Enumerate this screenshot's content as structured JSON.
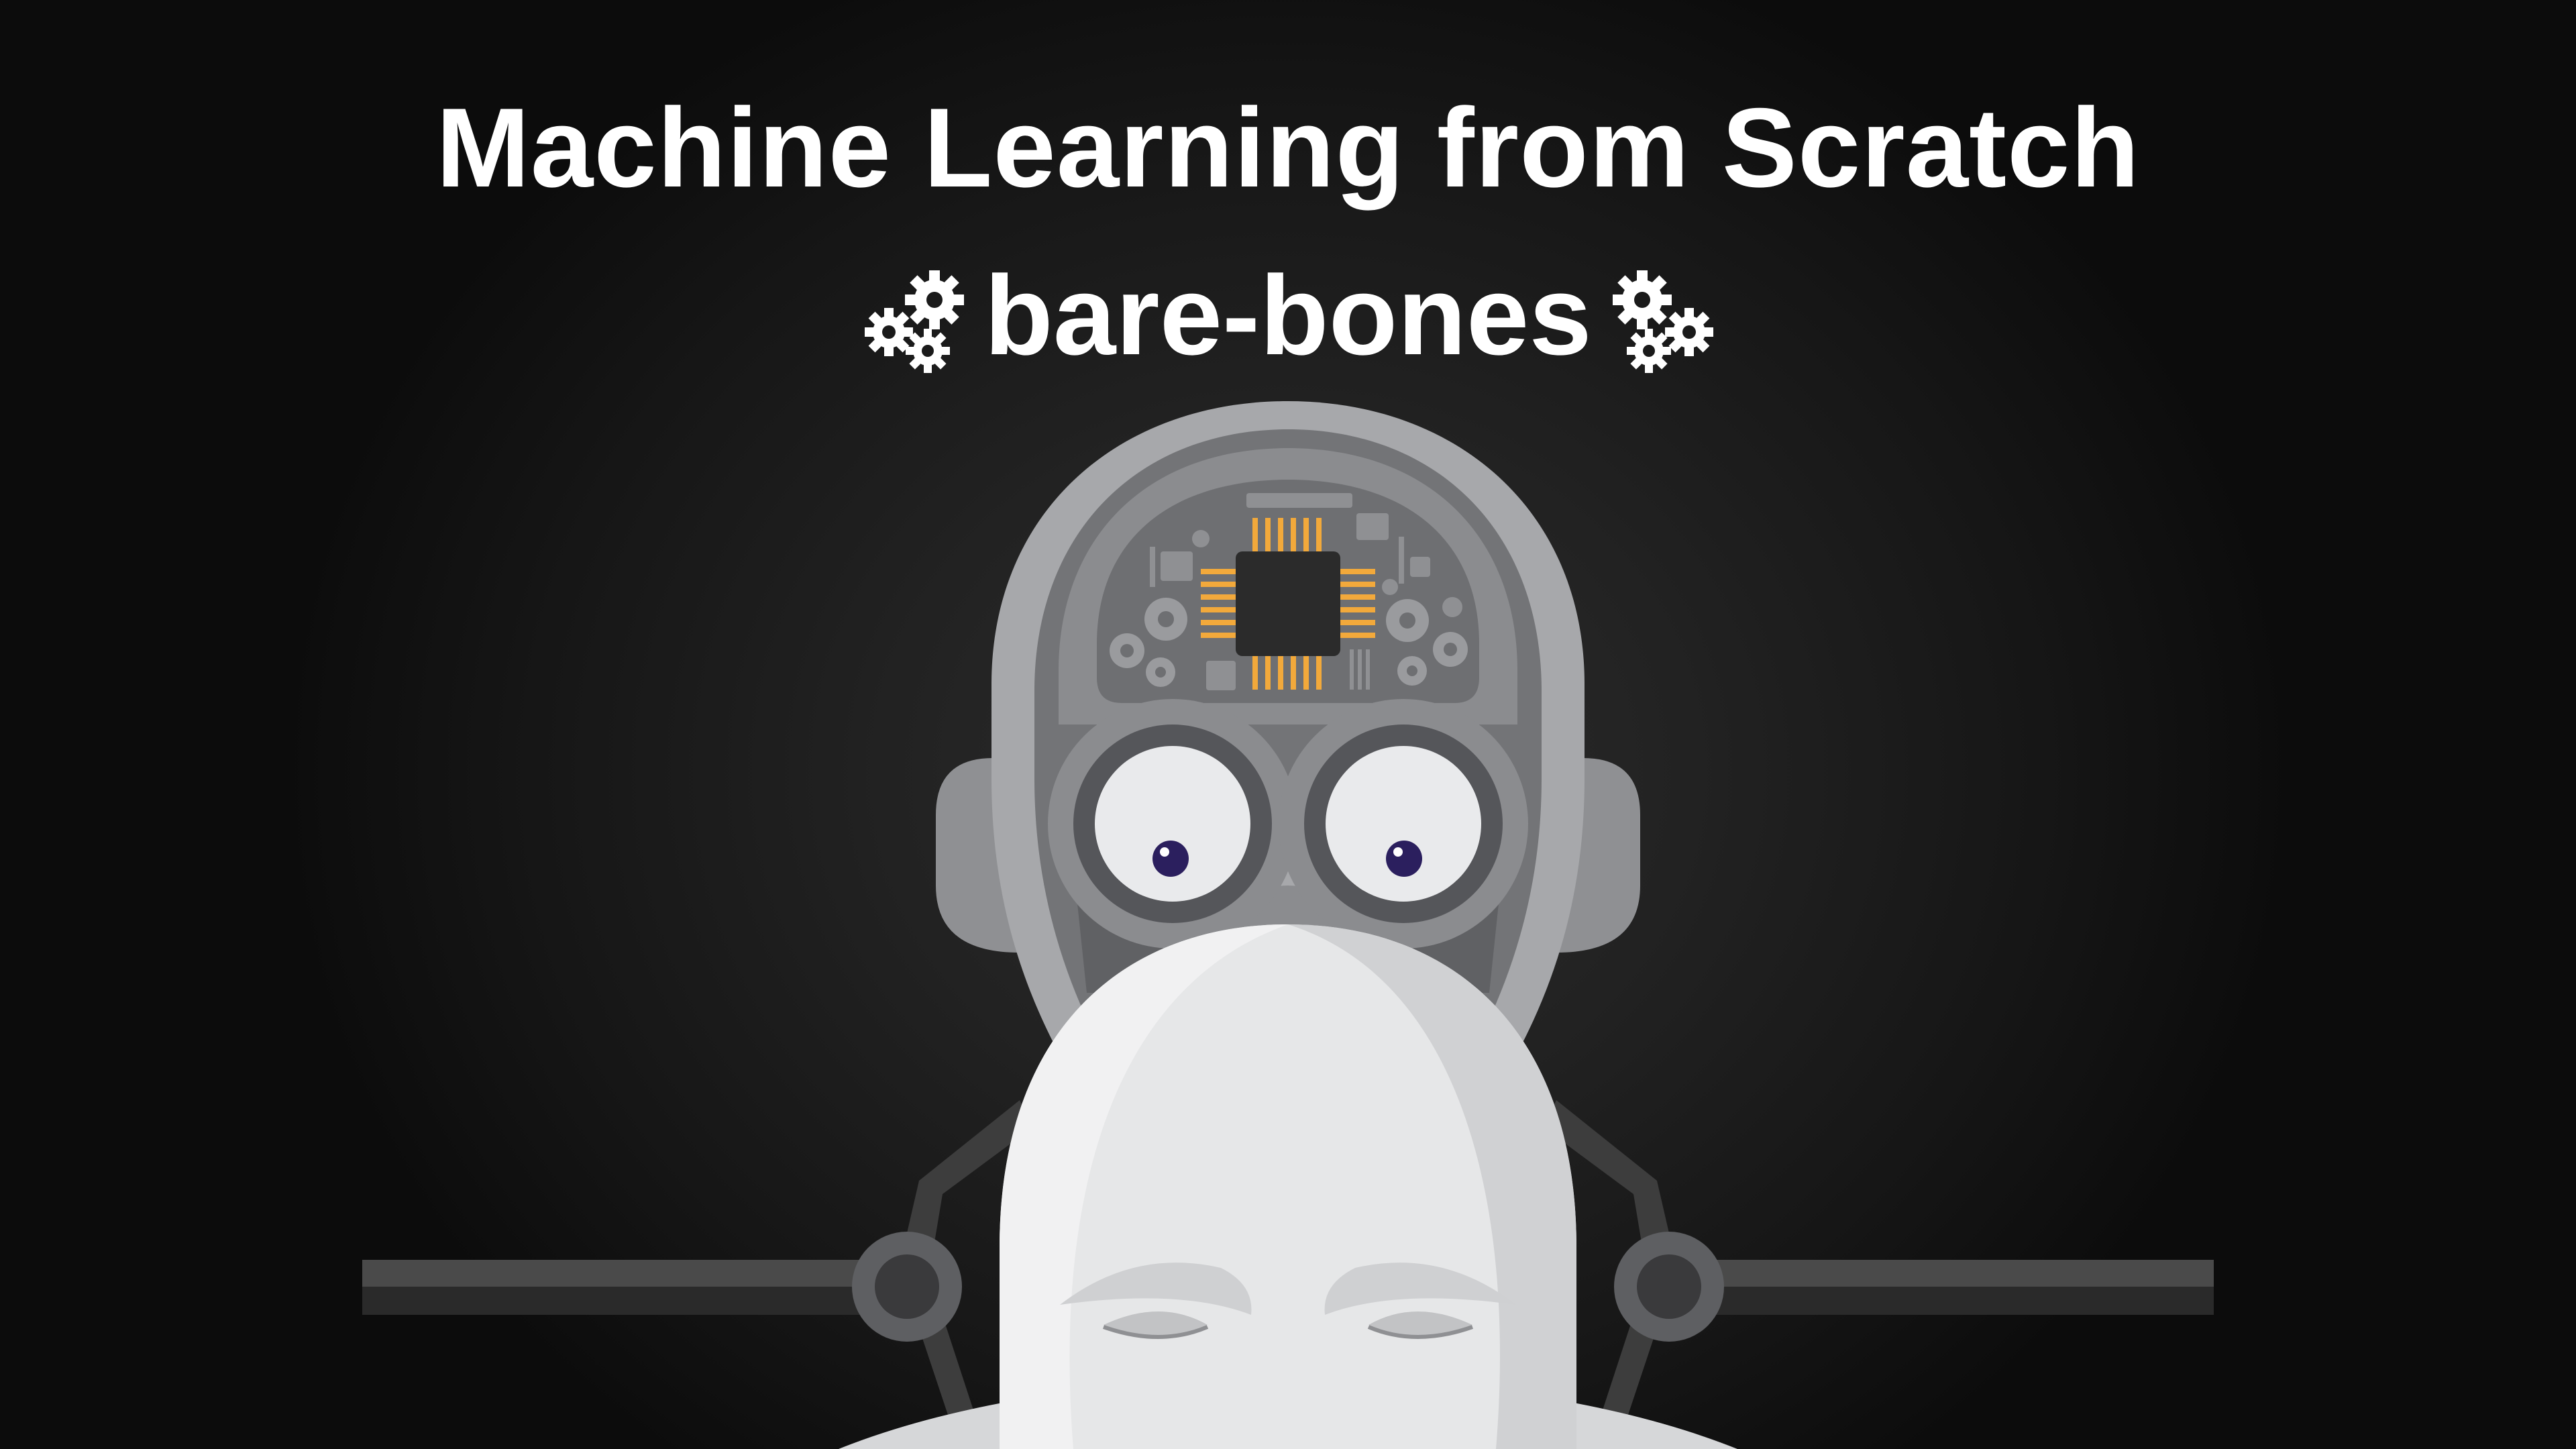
{
  "header": {
    "title": "Machine Learning from Scratch",
    "subtitle": "bare-bones"
  },
  "icons": {
    "left_gears": "gears-icon",
    "right_gears": "gears-icon"
  },
  "colors": {
    "background": "#1e1e1e",
    "text": "#ffffff",
    "robot_head_outer": "#a7a8ab",
    "robot_head_inner": "#7c7d80",
    "chip_body": "#2b2b2b",
    "chip_pins": "#f2a93b",
    "eye_pupil": "#2b1f5e",
    "human_head": "#e6e7e8"
  }
}
